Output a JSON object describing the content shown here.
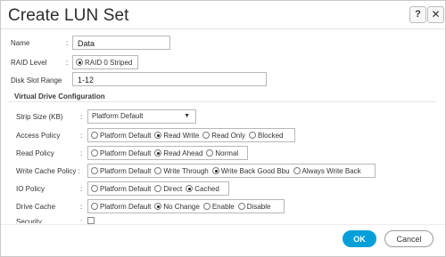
{
  "dialog": {
    "title": "Create LUN Set",
    "help_icon": "?",
    "close_icon": "✕"
  },
  "form": {
    "name_label": "Name",
    "name_value": "Data",
    "raid_label": "RAID Level",
    "raid_option": "RAID 0 Striped",
    "disk_slot_label": "Disk Slot Range",
    "disk_slot_value": "1-12",
    "section_title": "Virtual Drive Configuration",
    "strip_size_label": "Strip Size (KB)",
    "strip_size_value": "Platform Default",
    "access_policy_label": "Access Policy",
    "access_policy_options": [
      "Platform Default",
      "Read Write",
      "Read Only",
      "Blocked"
    ],
    "access_policy_selected": "Read Write",
    "read_policy_label": "Read Policy",
    "read_policy_options": [
      "Platform Default",
      "Read Ahead",
      "Normal"
    ],
    "read_policy_selected": "Read Ahead",
    "write_cache_label": "Write Cache Policy :",
    "write_cache_options": [
      "Platform Default",
      "Write Through",
      "Write Back Good Bbu",
      "Always Write Back"
    ],
    "write_cache_selected": "Write Back Good Bbu",
    "io_policy_label": "IO Policy",
    "io_policy_options": [
      "Platform Default",
      "Direct",
      "Cached"
    ],
    "io_policy_selected": "Cached",
    "drive_cache_label": "Drive Cache",
    "drive_cache_options": [
      "Platform Default",
      "No Change",
      "Enable",
      "Disable"
    ],
    "drive_cache_selected": "No Change",
    "security_label": "Security",
    "colon": ":"
  },
  "footer": {
    "ok_label": "OK",
    "cancel_label": "Cancel"
  },
  "colors": {
    "accent": "#049fd9"
  }
}
